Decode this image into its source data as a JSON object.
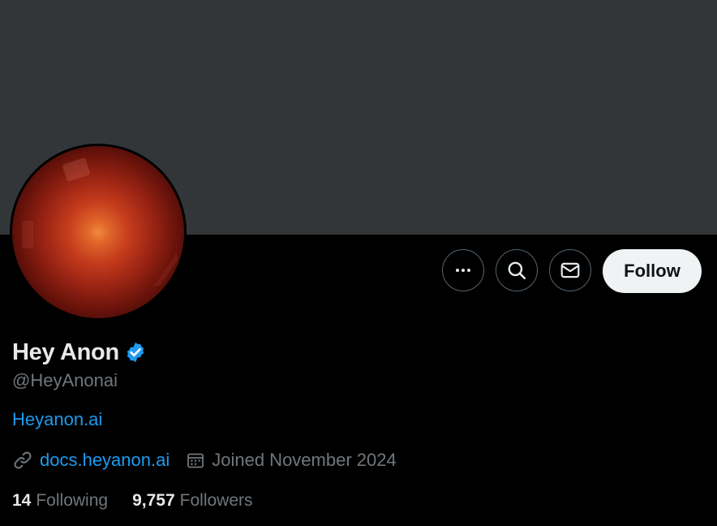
{
  "profile": {
    "display_name": "Hey Anon",
    "handle": "@HeyAnonai",
    "bio_link": "Heyanon.ai",
    "website": "docs.heyanon.ai",
    "joined": "Joined November 2024",
    "verified": true
  },
  "actions": {
    "more_icon": "more-icon",
    "search_icon": "search-icon",
    "message_icon": "envelope-icon",
    "follow_label": "Follow"
  },
  "stats": {
    "following_count": "14",
    "following_label": "Following",
    "followers_count": "9,757",
    "followers_label": "Followers"
  },
  "colors": {
    "background": "#000000",
    "banner": "#333639",
    "accent": "#1d9bf0",
    "secondary_text": "#71767b",
    "primary_text": "#e7e9ea",
    "follow_button_bg": "#eff3f4"
  }
}
